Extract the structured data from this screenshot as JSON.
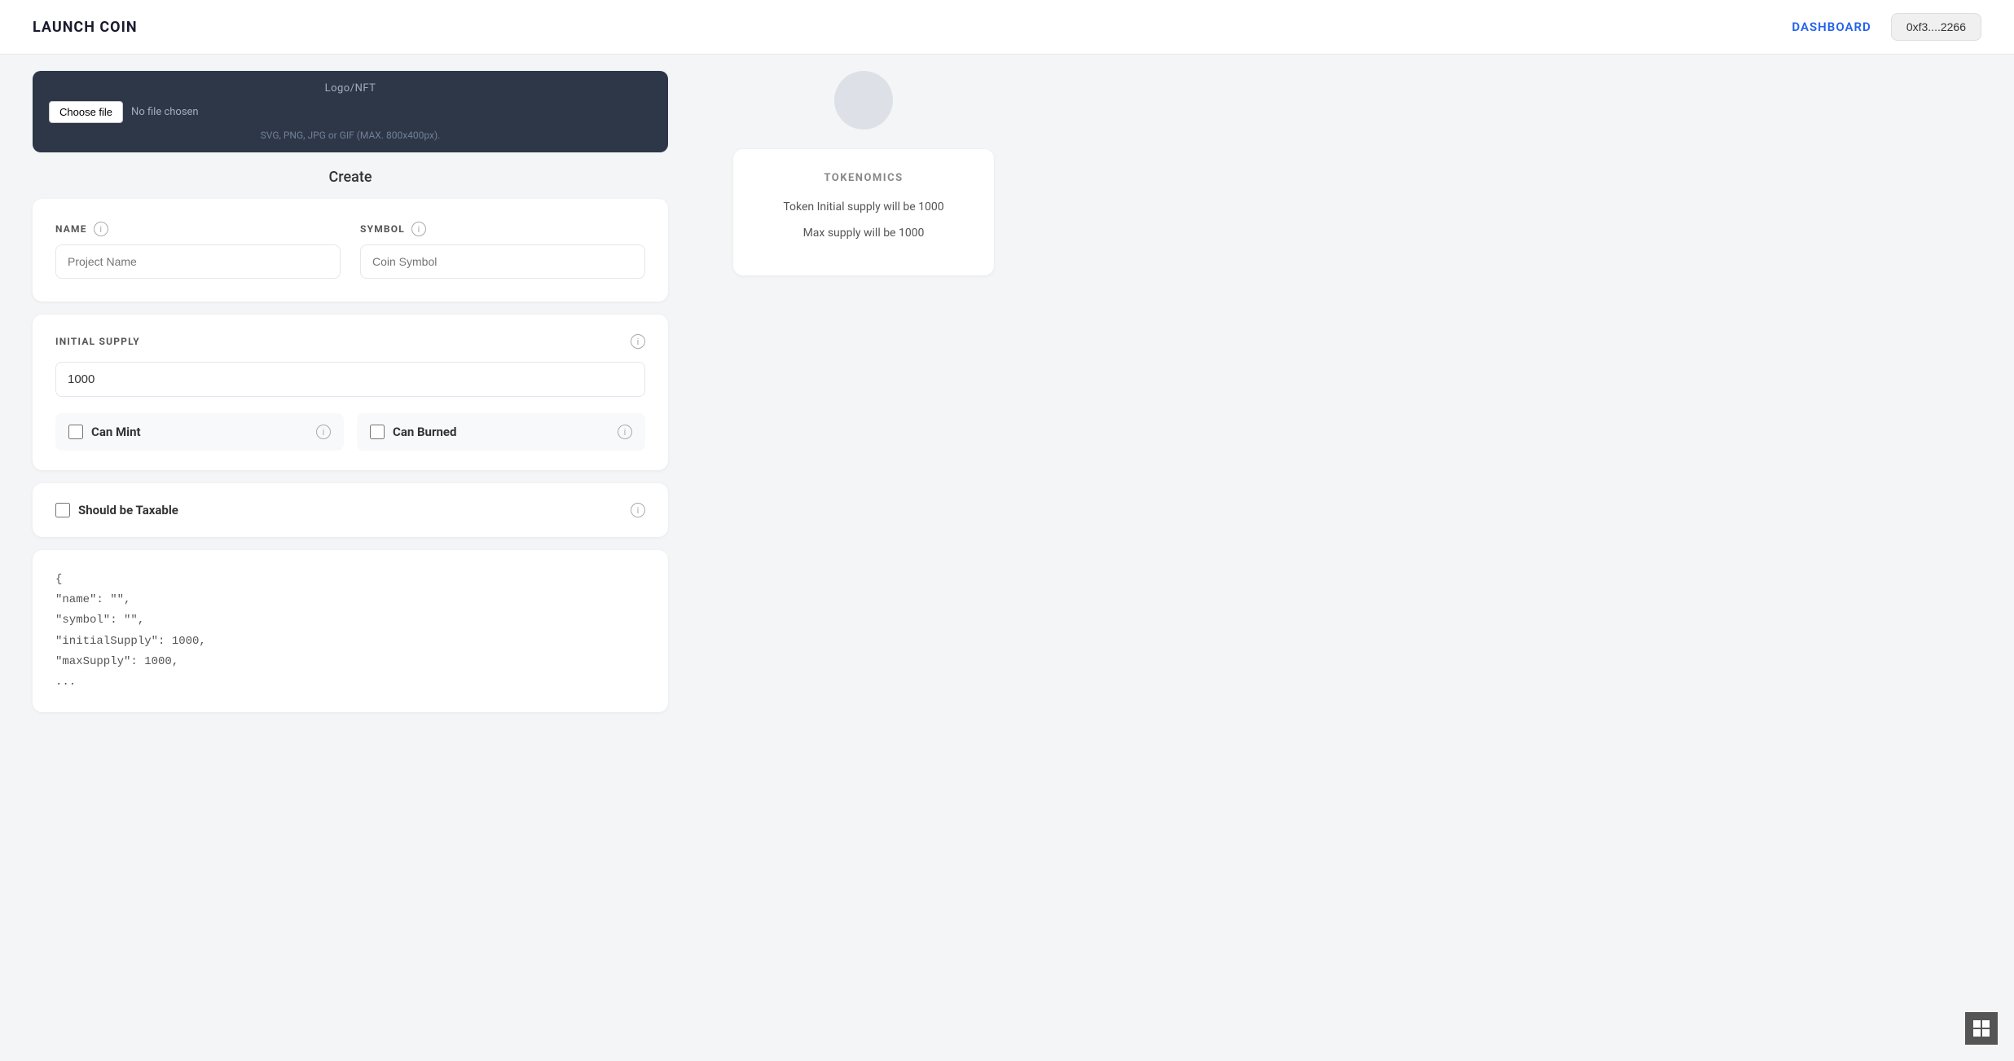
{
  "header": {
    "title": "LAUNCH COIN",
    "dashboard_label": "DASHBOARD",
    "wallet_address": "0xf3....2266"
  },
  "upload": {
    "label": "Logo/NFT",
    "choose_file_label": "Choose file",
    "no_file_text": "No file chosen",
    "file_hint": "SVG, PNG, JPG or GIF (MAX. 800x400px)."
  },
  "create": {
    "section_title": "Create",
    "name": {
      "label": "NAME",
      "placeholder": "Project Name"
    },
    "symbol": {
      "label": "SYMBOL",
      "placeholder": "Coin Symbol"
    },
    "initial_supply": {
      "label": "INITIAL SUPPLY",
      "value": "1000"
    },
    "can_mint": {
      "label": "Can Mint",
      "checked": false
    },
    "can_burned": {
      "label": "Can Burned",
      "checked": false
    },
    "should_be_taxable": {
      "label": "Should be Taxable",
      "checked": false
    }
  },
  "json_preview": {
    "line1": "{",
    "line2": "  \"name\": \"\",",
    "line3": "  \"symbol\": \"\",",
    "line4": "  \"initialSupply\": 1000,",
    "line5": "  \"maxSupply\": 1000,",
    "line6": "  ..."
  },
  "tokenomics": {
    "title": "TOKENOMICS",
    "initial_supply_text": "Token Initial supply will be 1000",
    "max_supply_text": "Max supply will be 1000"
  },
  "info_icon_label": "i",
  "colors": {
    "accent_blue": "#2563eb",
    "header_bg": "#ffffff",
    "card_bg": "#ffffff",
    "body_bg": "#f4f5f7",
    "upload_bg": "#2d3748"
  }
}
